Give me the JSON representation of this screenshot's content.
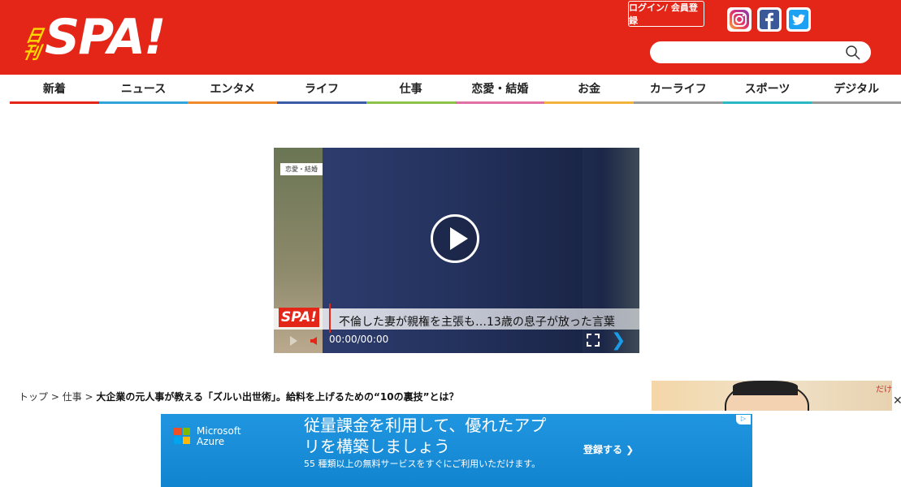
{
  "header": {
    "logo_kanji_top": "日",
    "logo_kanji_bottom": "刊",
    "logo_text": "SPA!",
    "login_label": "ログイン/ 会員登録",
    "search_placeholder": "",
    "brand_color": "#e32618"
  },
  "social": {
    "instagram": "instagram-icon",
    "facebook": "facebook-icon",
    "twitter": "twitter-icon"
  },
  "nav": [
    {
      "label": "新着",
      "color": "#e32618"
    },
    {
      "label": "ニュース",
      "color": "#33a3dc"
    },
    {
      "label": "エンタメ",
      "color": "#f08b2c"
    },
    {
      "label": "ライフ",
      "color": "#3b5ba9"
    },
    {
      "label": "仕事",
      "color": "#8dc34a"
    },
    {
      "label": "恋愛・結婚",
      "color": "#e06fa6"
    },
    {
      "label": "お金",
      "color": "#f2b33d"
    },
    {
      "label": "カーライフ",
      "color": "#9a9a9a"
    },
    {
      "label": "スポーツ",
      "color": "#2bb7c4"
    },
    {
      "label": "デジタル",
      "color": "#9a9a9a"
    }
  ],
  "video": {
    "category_tag": "恋愛・結婚",
    "logo_text": "SPA!",
    "caption": "不倫した妻が親権を主張も…13歳の息子が放った言葉",
    "time": "00:00/00:00"
  },
  "breadcrumb": {
    "top": "トップ",
    "sep1": " > ",
    "category": "仕事",
    "sep2": " > ",
    "current": "大企業の元人事が教える「ズルい出世術」。給料を上げるための“10の裏技”とは？"
  },
  "side_ad": {
    "text": "だけ"
  },
  "ad": {
    "brand_line1": "Microsoft",
    "brand_line2": "Azure",
    "headline": "従量課金を利用して、優れたアプリを構築しましょう",
    "sub": "55 種類以上の無料サービスをすぐにご利用いただけます。",
    "cta": "登録する ❯",
    "close": "✕"
  }
}
